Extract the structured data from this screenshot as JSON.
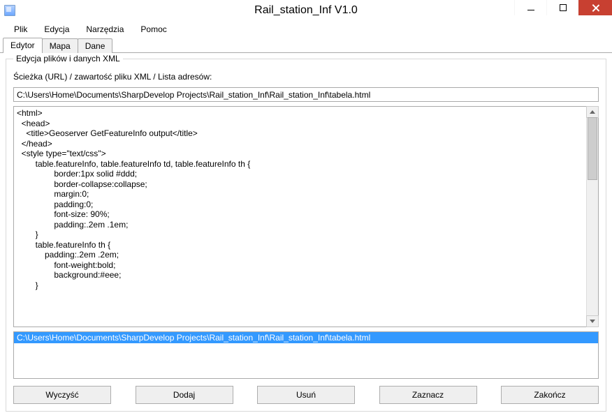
{
  "window": {
    "title": "Rail_station_Inf V1.0"
  },
  "menubar": {
    "items": [
      "Plik",
      "Edycja",
      "Narzędzia",
      "Pomoc"
    ]
  },
  "tabs": {
    "items": [
      "Edytor",
      "Mapa",
      "Dane"
    ],
    "active_index": 0
  },
  "groupbox": {
    "title": "Edycja plików i danych XML",
    "path_label": "Ścieżka (URL) / zawartość pliku XML / Lista adresów:",
    "path_value": "C:\\Users\\Home\\Documents\\SharpDevelop Projects\\Rail_station_Inf\\Rail_station_Inf\\tabela.html",
    "content_value": "<html>\n  <head>\n    <title>Geoserver GetFeatureInfo output</title>\n  </head>\n  <style type=\"text/css\">\n        table.featureInfo, table.featureInfo td, table.featureInfo th {\n                border:1px solid #ddd;\n                border-collapse:collapse;\n                margin:0;\n                padding:0;\n                font-size: 90%;\n                padding:.2em .1em;\n        }\n        table.featureInfo th {\n            padding:.2em .2em;\n                font-weight:bold;\n                background:#eee;\n        }",
    "list_items": [
      "C:\\Users\\Home\\Documents\\SharpDevelop Projects\\Rail_station_Inf\\Rail_station_Inf\\tabela.html"
    ],
    "list_selected_index": 0
  },
  "buttons": {
    "clear": "Wyczyść",
    "add": "Dodaj",
    "remove": "Usuń",
    "select": "Zaznacz",
    "quit": "Zakończ"
  }
}
